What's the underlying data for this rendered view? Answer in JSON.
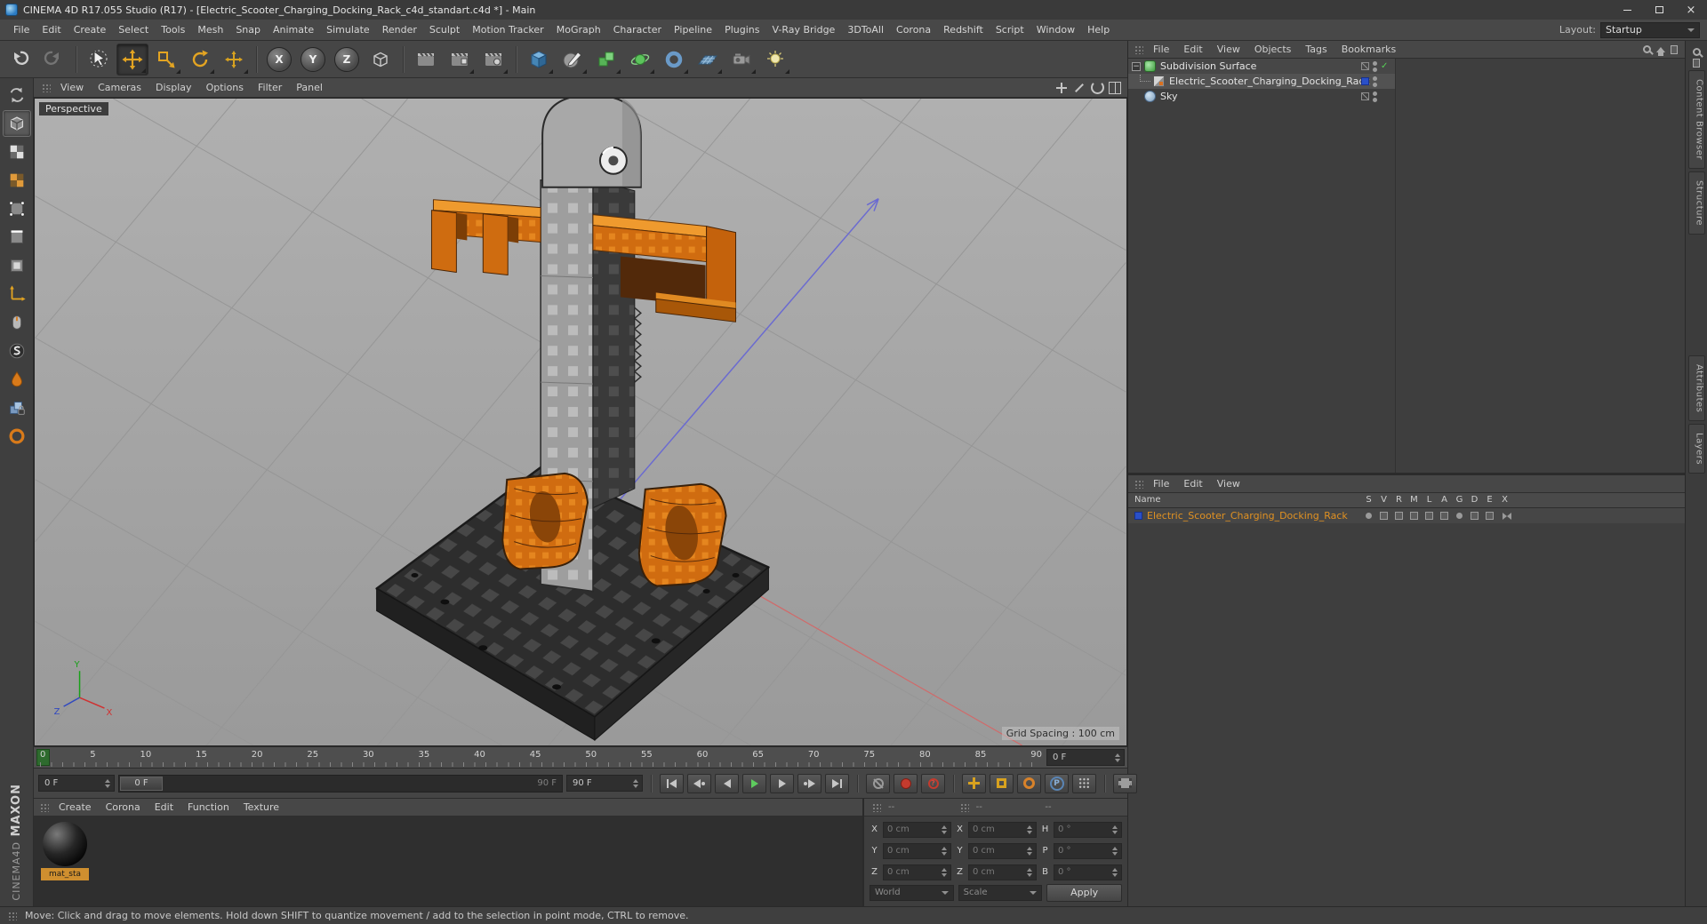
{
  "titlebar": {
    "title": "CINEMA 4D R17.055 Studio (R17) - [Electric_Scooter_Charging_Docking_Rack_c4d_standart.c4d *] - Main"
  },
  "menubar": {
    "items": [
      "File",
      "Edit",
      "Create",
      "Select",
      "Tools",
      "Mesh",
      "Snap",
      "Animate",
      "Simulate",
      "Render",
      "Sculpt",
      "Motion Tracker",
      "MoGraph",
      "Character",
      "Pipeline",
      "Plugins",
      "V-Ray Bridge",
      "3DToAll",
      "Corona",
      "Redshift",
      "Script",
      "Window",
      "Help"
    ],
    "layout_label": "Layout:",
    "layout_value": "Startup"
  },
  "toolbar": {
    "axis_labels": [
      "X",
      "Y",
      "Z"
    ]
  },
  "viewport": {
    "menu": [
      "View",
      "Cameras",
      "Display",
      "Options",
      "Filter",
      "Panel"
    ],
    "label": "Perspective",
    "grid_spacing": "Grid Spacing : 100 cm",
    "axis_x": "X",
    "axis_y": "Y",
    "axis_z": "Z"
  },
  "object_manager": {
    "menu": [
      "File",
      "Edit",
      "View",
      "Objects",
      "Tags",
      "Bookmarks"
    ],
    "objects": [
      {
        "name": "Subdivision Surface"
      },
      {
        "name": "Electric_Scooter_Charging_Docking_Rack"
      },
      {
        "name": "Sky"
      }
    ]
  },
  "layer_manager": {
    "menu": [
      "File",
      "Edit",
      "View"
    ],
    "name_header": "Name",
    "columns": [
      "S",
      "V",
      "R",
      "M",
      "L",
      "A",
      "G",
      "D",
      "E",
      "X"
    ],
    "row_name": "Electric_Scooter_Charging_Docking_Rack"
  },
  "timeline": {
    "ticks": [
      "0",
      "5",
      "10",
      "15",
      "20",
      "25",
      "30",
      "35",
      "40",
      "45",
      "50",
      "55",
      "60",
      "65",
      "70",
      "75",
      "80",
      "85",
      "90"
    ],
    "frame_field": "0 F",
    "range_start": "0 F",
    "slider_thumb": "0 F",
    "slider_end": "90 F",
    "range_end": "90 F"
  },
  "transport": {
    "p_label": "P",
    "question": "?"
  },
  "materials": {
    "menu": [
      "Create",
      "Corona",
      "Edit",
      "Function",
      "Texture"
    ],
    "material_name": "mat_sta"
  },
  "coordinates": {
    "headers": [
      "--",
      "--",
      "--"
    ],
    "labels": {
      "col1": [
        "X",
        "Y",
        "Z"
      ],
      "col2": [
        "X",
        "Y",
        "Z"
      ],
      "col3": [
        "H",
        "P",
        "B"
      ]
    },
    "position": [
      "0 cm",
      "0 cm",
      "0 cm"
    ],
    "size": [
      "0 cm",
      "0 cm",
      "0 cm"
    ],
    "rotation": [
      "0 °",
      "0 °",
      "0 °"
    ],
    "world": "World",
    "scale": "Scale",
    "apply": "Apply"
  },
  "statusbar": {
    "text": "Move: Click and drag to move elements. Hold down SHIFT to quantize movement / add to the selection in point mode, CTRL to remove."
  },
  "branding": {
    "maxon": "MAXON",
    "cinema": "CINEMA4D"
  },
  "right_strip": {
    "tabs": [
      "Content Browser",
      "Structure",
      "Attributes",
      "Layers"
    ]
  },
  "icons": {
    "close": "×",
    "check": "✓",
    "collapse": "−"
  }
}
